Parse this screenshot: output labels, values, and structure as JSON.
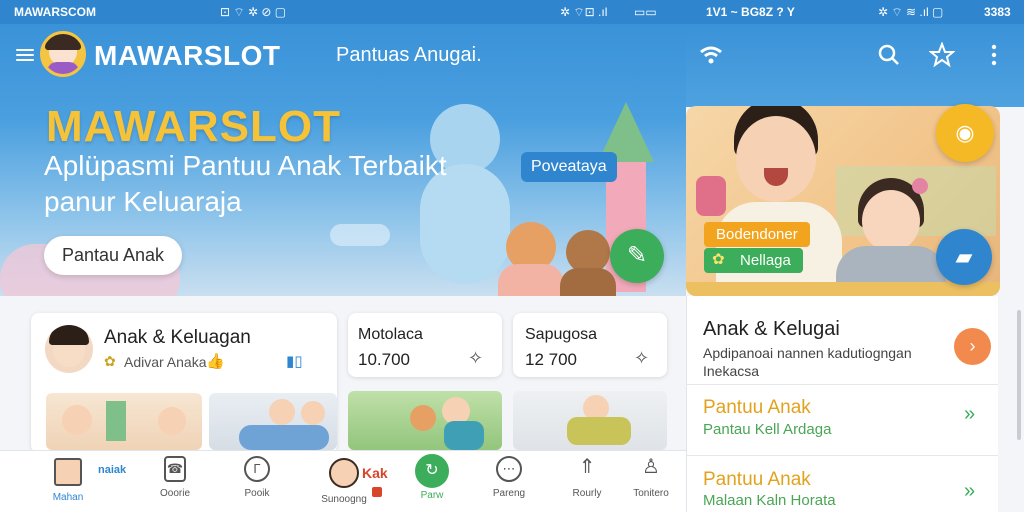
{
  "statusbar": {
    "left_text": "MAWARSCOM",
    "left_icons": "⊡ ⌔ ✲ ⊘ ▢",
    "mid_icons": "✲ ⌔⊡ .ıl",
    "mid_battery": "▭▭",
    "mid2_text": "1V1 ~ BG8Z ? Y",
    "right_icons": "✲ ⌔ ≋ .ıl ▢",
    "right_time": "3383"
  },
  "header": {
    "brand": "MAWARSLOT",
    "title": "Pantuas Anugai.",
    "search_icon": "search-icon",
    "star_icon": "star-icon",
    "more_icon": "more-vertical-icon"
  },
  "hero": {
    "headline": "MAWARSLOT",
    "subtitle_line1": "Aplüpasmi Pantuu Anak Terbaikt",
    "subtitle_line2": "panur Keluaraja",
    "tag": "Poveataya",
    "cta": "Pantau Anak"
  },
  "photo_card": {
    "badge1": "Bodendoner",
    "badge2": "Nellaga"
  },
  "profile_card": {
    "name": "Anak & Keluagan",
    "sub": "Adivar Anaka",
    "chart_glyph": "▮▯"
  },
  "stats": [
    {
      "title": "Motolaca",
      "value": "10.700"
    },
    {
      "title": "Sapugosa",
      "value": "12 700"
    }
  ],
  "right_panel": {
    "title": "Anak & Kelugai",
    "desc_line1": "Apdipanoai nannen kadutiogngan",
    "desc_line2": "Inekacsa",
    "items": [
      {
        "title": "Pantuu Anak",
        "sub": "Pantau Kell Ardaga"
      },
      {
        "title": "Pantuu Anak",
        "sub": "Malaan Kaln Horata"
      }
    ]
  },
  "bottom_nav": [
    {
      "label": "Mahan",
      "badge": "naiak",
      "icon": "child-icon"
    },
    {
      "label": "Ooorie",
      "icon": "phone-icon"
    },
    {
      "label": "Pooik",
      "icon": "document-icon"
    },
    {
      "label": "Sunoogng",
      "badge": "Kak",
      "icon": "profile-icon"
    },
    {
      "label": "Parw",
      "icon": "refresh-icon"
    },
    {
      "label": "Pareng",
      "icon": "chat-icon"
    },
    {
      "label": "Rourly",
      "icon": "rocket-icon"
    },
    {
      "label": "Tonitero",
      "icon": "user-icon"
    }
  ],
  "colors": {
    "primary": "#2f86cf",
    "accent_yellow": "#f6c338",
    "green": "#3cad5a",
    "orange": "#f38a4d"
  }
}
